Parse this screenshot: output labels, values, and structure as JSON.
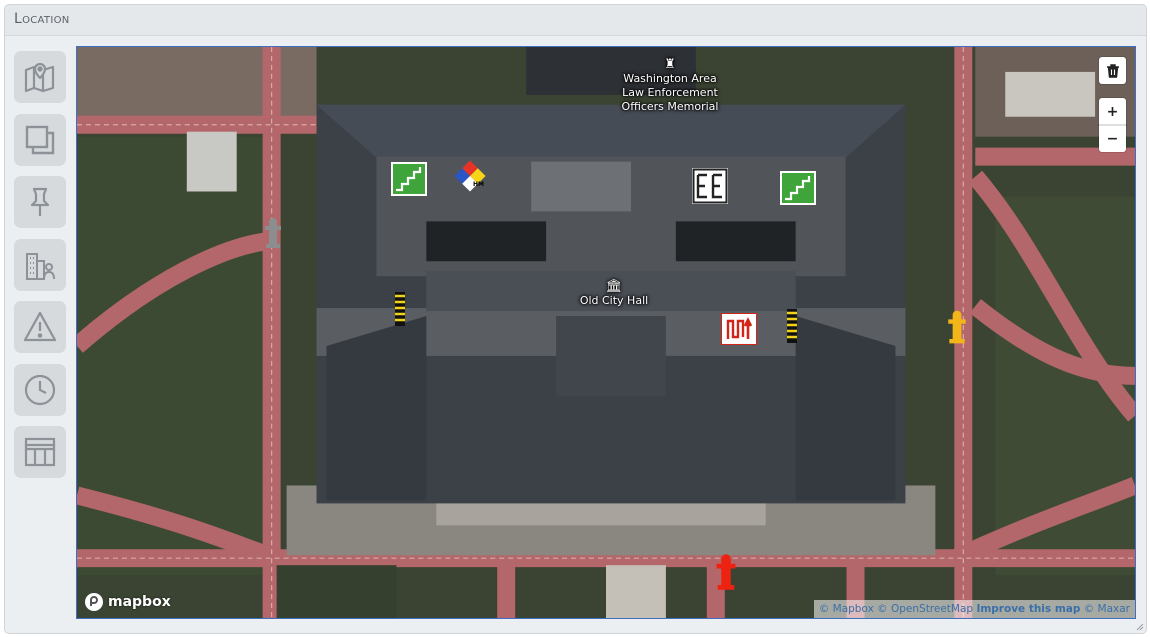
{
  "panel": {
    "title": "Location"
  },
  "toolbar": {
    "items": [
      {
        "icon": "map-pin-icon"
      },
      {
        "icon": "layers-icon"
      },
      {
        "icon": "pushpin-icon"
      },
      {
        "icon": "buildings-person-icon"
      },
      {
        "icon": "warning-icon"
      },
      {
        "icon": "clock-icon"
      },
      {
        "icon": "table-icon"
      }
    ]
  },
  "map": {
    "poi_memorial": "Washington Area\nLaw Enforcement\nOfficers Memorial",
    "poi_cityhall": "Old City Hall",
    "controls": {
      "zoom_in": "+",
      "zoom_out": "−"
    },
    "logo": "mapbox",
    "attribution": {
      "mapbox": "© Mapbox",
      "osm": "© OpenStreetMap",
      "improve": "Improve this map",
      "maxar": "© Maxar"
    },
    "markers": [
      {
        "icon": "stairs-icon"
      },
      {
        "icon": "hazmat-icon"
      },
      {
        "icon": "elevator-icon"
      },
      {
        "icon": "stairs-icon"
      },
      {
        "icon": "standpipe-icon"
      },
      {
        "icon": "standpipe-icon"
      },
      {
        "icon": "sprinkler-riser-icon"
      },
      {
        "icon": "hydrant-gray-icon"
      },
      {
        "icon": "hydrant-yellow-icon"
      },
      {
        "icon": "hydrant-red-icon"
      }
    ],
    "colors": {
      "walkway": "#b4676a",
      "roof": "#3b4048",
      "grass": "#3d4a33",
      "hydrant_red": "#ee2211",
      "hydrant_yellow": "#f2b51a"
    }
  }
}
